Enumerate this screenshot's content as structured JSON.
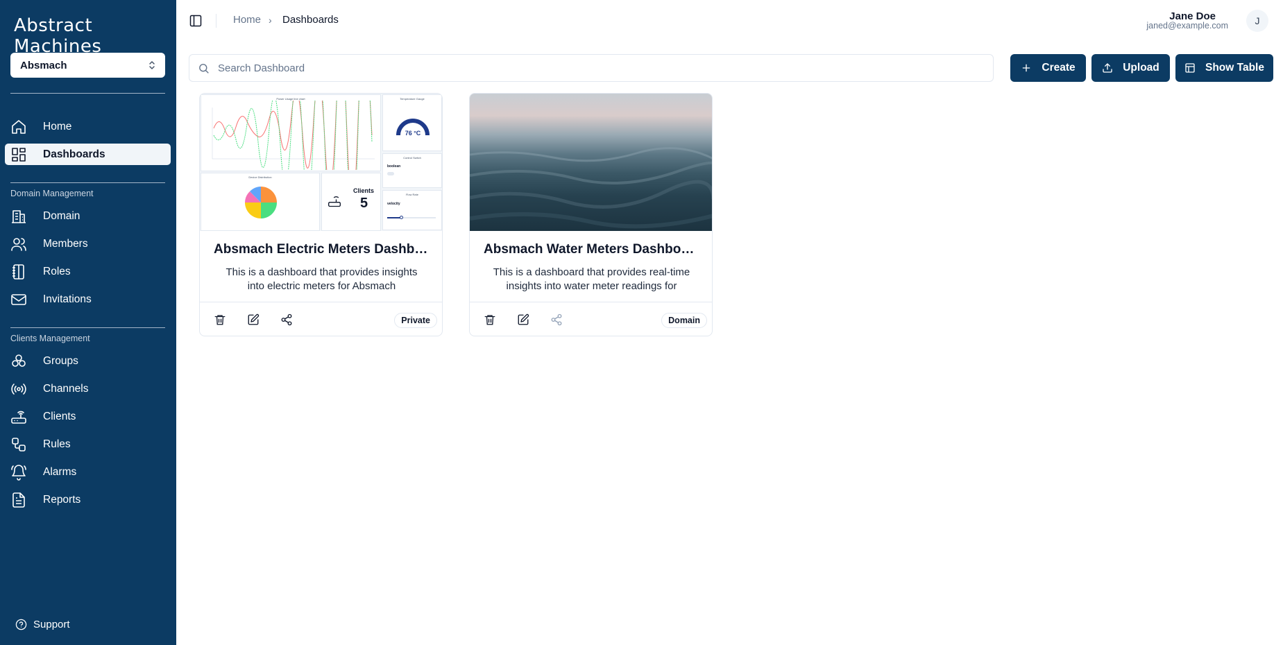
{
  "app": {
    "logo": "Abstract Machines",
    "domain_selector": "Absmach"
  },
  "sidebar": {
    "main_items": [
      {
        "label": "Home",
        "icon": "home-icon"
      },
      {
        "label": "Dashboards",
        "icon": "dashboards-icon",
        "active": true
      }
    ],
    "domain_management": {
      "heading": "Domain Management",
      "items": [
        {
          "label": "Domain",
          "icon": "building-icon"
        },
        {
          "label": "Members",
          "icon": "users-icon"
        },
        {
          "label": "Roles",
          "icon": "notebook-icon"
        },
        {
          "label": "Invitations",
          "icon": "mail-icon"
        }
      ]
    },
    "clients_management": {
      "heading": "Clients Management",
      "items": [
        {
          "label": "Groups",
          "icon": "groups-icon"
        },
        {
          "label": "Channels",
          "icon": "radio-icon"
        },
        {
          "label": "Clients",
          "icon": "router-icon"
        },
        {
          "label": "Rules",
          "icon": "workflow-icon"
        },
        {
          "label": "Alarms",
          "icon": "bell-icon"
        },
        {
          "label": "Reports",
          "icon": "file-text-icon"
        }
      ]
    },
    "support": "Support"
  },
  "header": {
    "breadcrumb": {
      "home": "Home",
      "separator": "›",
      "current": "Dashboards"
    },
    "user": {
      "name": "Jane Doe",
      "email": "janed@example.com",
      "initial": "J"
    }
  },
  "toolbar": {
    "search_placeholder": "Search Dashboard",
    "create_label": "Create",
    "upload_label": "Upload",
    "show_table_label": "Show Table"
  },
  "dashboards": [
    {
      "title": "Absmach Electric Meters Dashboard",
      "description": "This is a dashboard that provides insights into electric meters for Absmach",
      "visibility": "Private",
      "thumbnail": {
        "line_chart_title": "Power Usage line chart",
        "gauge_title": "Temperature Gauge",
        "gauge_value": "76 °C",
        "switch_title": "Control Switch",
        "switch_label": "boolean",
        "pie_title": "Device Distribution",
        "clients_title": "Clients",
        "clients_value": "5",
        "slider_title": "Flow Rate",
        "slider_label": "velocity"
      }
    },
    {
      "title": "Absmach Water Meters Dashboard",
      "description": "This is a dashboard that provides real-time insights into water meter readings for Absmach",
      "visibility": "Domain"
    }
  ],
  "colors": {
    "sidebar_bg": "#0c3b63",
    "primary_button": "#0c3b63",
    "active_nav_bg": "#f1f5f9"
  }
}
